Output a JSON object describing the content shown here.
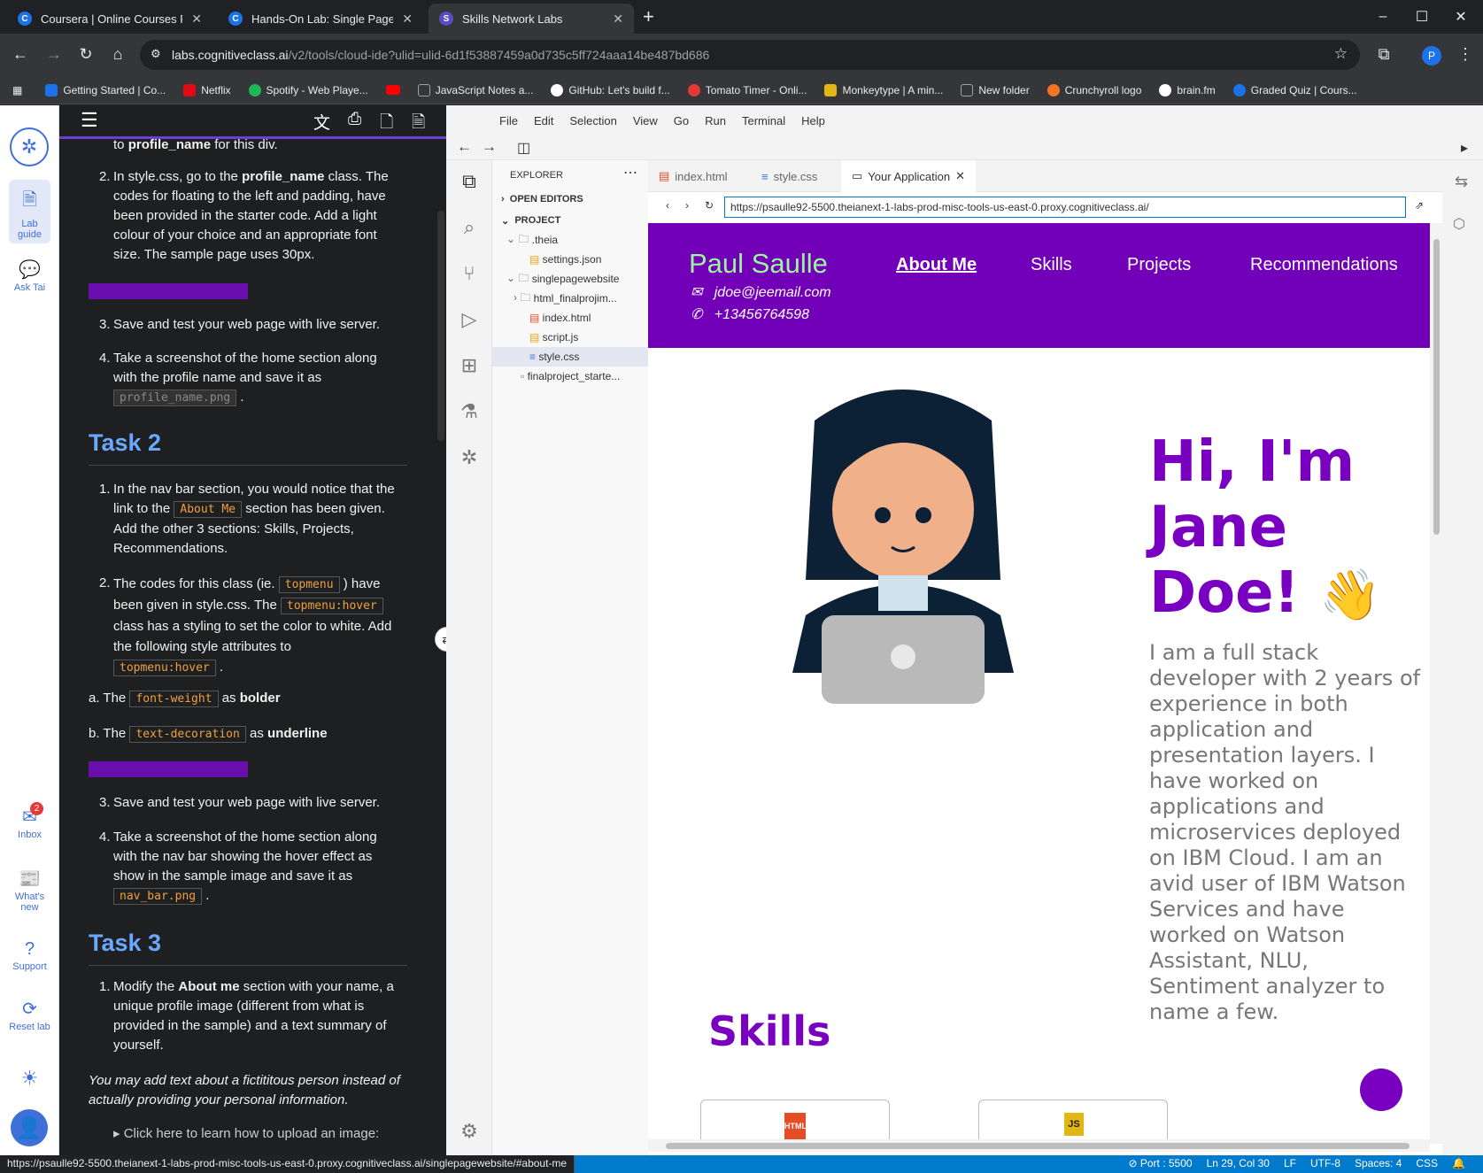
{
  "browser": {
    "tabs": [
      {
        "title": "Coursera | Online Courses From",
        "icon": "C"
      },
      {
        "title": "Hands-On Lab: Single Page Por",
        "icon": "C"
      },
      {
        "title": "Skills Network Labs",
        "icon": "S"
      }
    ],
    "url_host": "labs.cognitiveclass.ai",
    "url_path": "/v2/tools/cloud-ide?ulid=ulid-6d1f53887459a0d735c5ff724aaa14be487bd686",
    "profile_initial": "P",
    "bookmarks": [
      {
        "label": "Getting Started | Co...",
        "color": "#1a73e8"
      },
      {
        "label": "Netflix",
        "color": "#e50914"
      },
      {
        "label": "Spotify - Web Playe...",
        "color": "#1db954"
      },
      {
        "label": "",
        "color": "#ff0000"
      },
      {
        "label": "JavaScript Notes a...",
        "color": "#9aa0a6"
      },
      {
        "label": "GitHub: Let's build f...",
        "color": "#ffffff"
      },
      {
        "label": "Tomato Timer - Onli...",
        "color": "#e53935"
      },
      {
        "label": "Monkeytype | A min...",
        "color": "#e2b714"
      },
      {
        "label": "New folder",
        "color": "#9aa0a6"
      },
      {
        "label": "Crunchyroll logo",
        "color": "#f47521"
      },
      {
        "label": "brain.fm",
        "color": "#ffffff"
      },
      {
        "label": "Graded Quiz | Cours...",
        "color": "#1a73e8"
      }
    ]
  },
  "rail": {
    "lab_guide": "Lab guide",
    "ask_tai": "Ask Tai",
    "inbox": "Inbox",
    "inbox_count": "2",
    "whats_new": "What's new",
    "support": "Support",
    "reset_lab": "Reset lab"
  },
  "guide": {
    "top_fragment_pre": "to",
    "top_fragment_bold": "profile_name",
    "top_fragment_post": "for this div.",
    "step2_num": "2.",
    "step2_a": "In style.css, go to the",
    "step2_bold": "profile_name",
    "step2_b": "class. The codes for floating to the left and padding, have been provided in the starter code. Add a light colour of your choice and an appropriate font size. The sample page uses 30px.",
    "step3_num": "3.",
    "step3": "Save and test your web page with live server.",
    "step4_num": "4.",
    "step4": "Take a screenshot of the home section along with the profile name and save it as",
    "step4_code": "profile_name.png",
    "task2": "Task 2",
    "t2s1_num": "1.",
    "t2s1_a": "In the nav bar section, you would notice that the link to the",
    "t2s1_code": "About Me",
    "t2s1_b": "section has been given. Add the other 3 sections: Skills, Projects, Recommendations.",
    "t2s2_num": "2.",
    "t2s2_a": "The codes for this class (ie.",
    "t2s2_code1": "topmenu",
    "t2s2_b": ") have been given in style.css. The",
    "t2s2_code2": "topmenu:hover",
    "t2s2_c": "class has a styling to set the color to white. Add the following style attributes to",
    "t2s2_code3": "topmenu:hover",
    "a_prefix": "a. The",
    "a_code": "font-weight",
    "a_mid": "as",
    "a_bold": "bolder",
    "b_prefix": "b. The",
    "b_code": "text-decoration",
    "b_mid": "as",
    "b_bold": "underline",
    "t2s3_num": "3.",
    "t2s3": "Save and test your web page with live server.",
    "t2s4_num": "4.",
    "t2s4": "Take a screenshot of the home section along with the nav bar showing the hover effect as show in the sample image and save it as",
    "t2s4_code": "nav_bar.png",
    "task3": "Task 3",
    "t3s1_num": "1.",
    "t3s1_a": "Modify the",
    "t3s1_bold": "About me",
    "t3s1_b": "section with your name, a unique profile image (different from what is provided in the sample) and a text summary of yourself.",
    "t3_italic": "You may add text about a fictititous person instead of actually providing your personal information.",
    "t3_details": "Click here to learn how to upload an image:"
  },
  "ide": {
    "menu": [
      "File",
      "Edit",
      "Selection",
      "View",
      "Go",
      "Run",
      "Terminal",
      "Help"
    ],
    "explorer_title": "EXPLORER",
    "open_editors": "OPEN EDITORS",
    "project": "PROJECT",
    "tree": [
      {
        "label": ".theia",
        "kind": "folder"
      },
      {
        "label": "settings.json",
        "kind": "json"
      },
      {
        "label": "singlepagewebsite",
        "kind": "folder"
      },
      {
        "label": "html_finalprojim...",
        "kind": "folder"
      },
      {
        "label": "index.html",
        "kind": "html"
      },
      {
        "label": "script.js",
        "kind": "js"
      },
      {
        "label": "style.css",
        "kind": "css"
      },
      {
        "label": "finalproject_starte...",
        "kind": "file"
      }
    ],
    "editor_tabs": [
      "index.html",
      "style.css",
      "Your Application"
    ],
    "preview_url": "https://psaulle92-5500.theianext-1-labs-prod-misc-tools-us-east-0.proxy.cognitiveclass.ai/"
  },
  "preview": {
    "name": "Paul Saulle",
    "email": "jdoe@jeemail.com",
    "phone": "+13456764598",
    "nav": [
      "About Me",
      "Skills",
      "Projects",
      "Recommendations"
    ],
    "hi_line1": "Hi, I'm",
    "hi_line2": "Jane",
    "hi_line3": "Doe!",
    "wave": "👋",
    "summary": "I am a full stack developer with 2 years of experience in both application and presentation layers. I have worked on applications and microservices deployed on IBM Cloud. I am an avid user of IBM Watson Services and have worked on Watson Assistant, NLU, Sentiment analyzer to name a few.",
    "skills_heading": "Skills",
    "card1": "HTML",
    "card2": "JS"
  },
  "status": {
    "link_url": "https://psaulle92-5500.theianext-1-labs-prod-misc-tools-us-east-0.proxy.cognitiveclass.ai/singlepagewebsite/#about-me",
    "port": "Port : 5500",
    "position": "Ln 29, Col 30",
    "eol": "LF",
    "encoding": "UTF-8",
    "spaces": "Spaces: 4",
    "language": "CSS"
  },
  "colors": {
    "accent": "#7900c0",
    "header_purple": "#7200b8",
    "guide_heading": "#6aa7ff",
    "status_blue": "#007acc"
  }
}
